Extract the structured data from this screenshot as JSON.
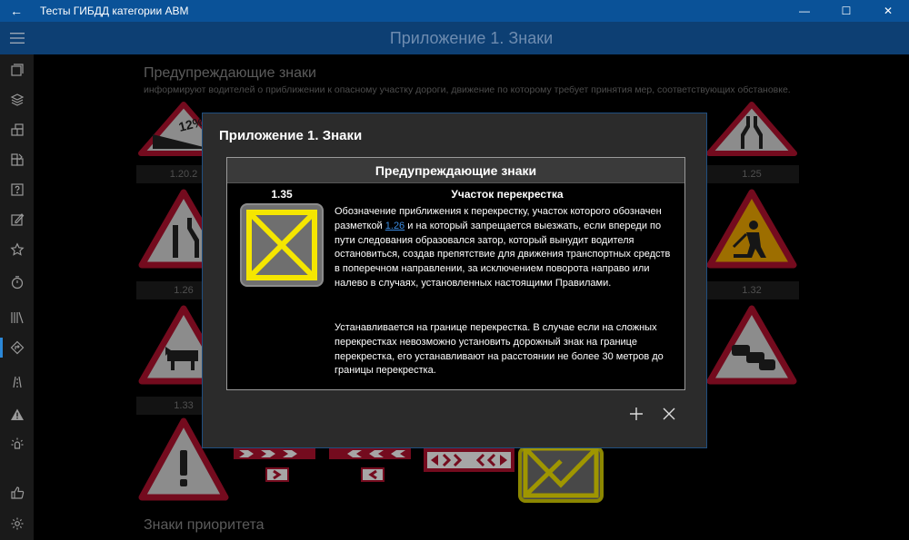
{
  "window": {
    "title": "Тесты ГИБДД категории АВМ",
    "back_glyph": "←",
    "minimize_glyph": "—",
    "maximize_glyph": "☐",
    "close_glyph": "✕"
  },
  "header": {
    "title": "Приложение 1. Знаки"
  },
  "sidebar": {
    "items": [
      {
        "name": "tickets-icon"
      },
      {
        "name": "topics-icon"
      },
      {
        "name": "exam-icon"
      },
      {
        "name": "marathon-icon"
      },
      {
        "name": "questions-icon"
      },
      {
        "name": "mistakes-icon"
      },
      {
        "name": "favorites-icon"
      },
      {
        "name": "timer-icon"
      },
      {
        "name": "rules-icon"
      },
      {
        "name": "signs-icon",
        "active": true
      },
      {
        "name": "marking-icon"
      },
      {
        "name": "warning-icon"
      },
      {
        "name": "lights-icon"
      },
      {
        "name": "like-icon"
      },
      {
        "name": "settings-icon"
      }
    ]
  },
  "main": {
    "section_title": "Предупреждающие знаки",
    "section_desc": "информируют водителей о приближении к опасному участку дороги, движение по которому требует принятия мер, соответствующих обстановке.",
    "section2_title": "Знаки приоритета",
    "labels": {
      "l1": "1.20.2",
      "l2": "1.25",
      "l3": "1.26",
      "l4": "1.32",
      "l5": "1.33"
    },
    "sign_text_12": "12%"
  },
  "dialog": {
    "title": "Приложение 1. Знаки",
    "panel_title": "Предупреждающие знаки",
    "sign_number": "1.35",
    "sign_name": "Участок перекрестка",
    "text_before_link": "Обозначение приближения к перекрестку, участок которого обозначен разметкой ",
    "link": "1.26",
    "text_after_link": " и на который запрещается выезжать, если впереди по пути следования образовался затор, который вынудит водителя остановиться, создав препятствие для движения транспортных средств в поперечном направлении, за исключением поворота направо или налево в случаях, установленных настоящими Правилами.",
    "paragraph2": "Устанавливается на границе перекрестка. В случае если на сложных перекрестках невозможно установить дорожный знак на границе перекрестка, его устанавливают на расстоянии не более 30 метров до границы перекрестка.",
    "add_glyph": "+",
    "close_glyph": "✕"
  },
  "colors": {
    "titlebar": "#0a5298",
    "header": "#0d3f73",
    "accent": "#2b88d8",
    "sign_yellow": "#f5e600",
    "sign_red": "#c8102e",
    "sign_grey": "#6f6f6f"
  }
}
